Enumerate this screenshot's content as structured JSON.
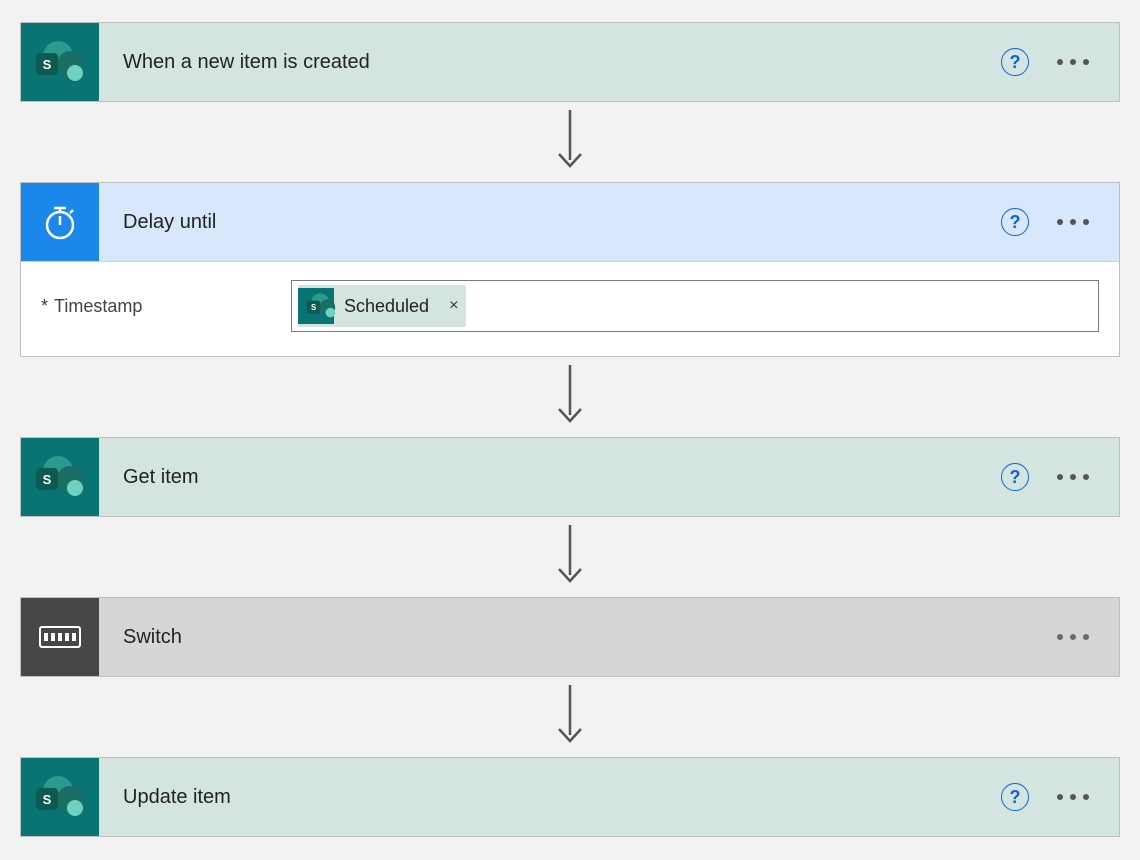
{
  "steps": {
    "trigger": {
      "title": "When a new item is created"
    },
    "delay": {
      "title": "Delay until"
    },
    "get": {
      "title": "Get item"
    },
    "switch": {
      "title": "Switch"
    },
    "update": {
      "title": "Update item"
    }
  },
  "delay_panel": {
    "field_label": "Timestamp",
    "required_marker": "*",
    "token": {
      "label": "Scheduled",
      "remove_label": "×"
    }
  },
  "icons": {
    "help_glyph": "?",
    "sharepoint_letter": "S"
  }
}
